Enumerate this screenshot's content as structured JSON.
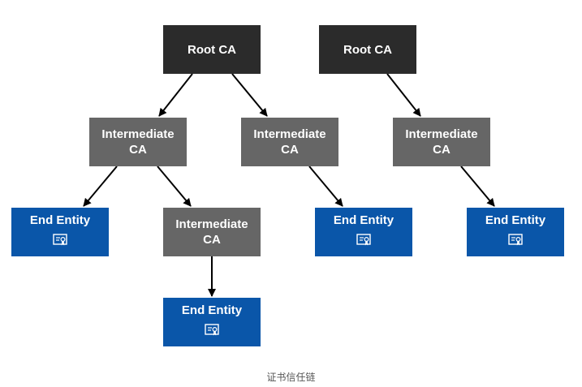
{
  "diagram": {
    "caption": "证书信任链",
    "colors": {
      "root": "#2b2b2b",
      "intermediate": "#666666",
      "end_entity": "#0a56a9",
      "arrow": "#000000"
    },
    "nodes": [
      {
        "id": "root1",
        "type": "root",
        "lines": [
          "Root CA"
        ]
      },
      {
        "id": "root2",
        "type": "root",
        "lines": [
          "Root CA"
        ]
      },
      {
        "id": "int1",
        "type": "intermediate",
        "lines": [
          "Intermediate",
          "CA"
        ]
      },
      {
        "id": "int2",
        "type": "intermediate",
        "lines": [
          "Intermediate",
          "CA"
        ]
      },
      {
        "id": "int3",
        "type": "intermediate",
        "lines": [
          "Intermediate",
          "CA"
        ]
      },
      {
        "id": "int4",
        "type": "intermediate",
        "lines": [
          "Intermediate",
          "CA"
        ]
      },
      {
        "id": "end1",
        "type": "end",
        "lines": [
          "End Entity"
        ],
        "icon": "certificate-icon"
      },
      {
        "id": "end2",
        "type": "end",
        "lines": [
          "End Entity"
        ],
        "icon": "certificate-icon"
      },
      {
        "id": "end3",
        "type": "end",
        "lines": [
          "End Entity"
        ],
        "icon": "certificate-icon"
      },
      {
        "id": "end4",
        "type": "end",
        "lines": [
          "End Entity"
        ],
        "icon": "certificate-icon"
      }
    ],
    "edges": [
      {
        "from": "root1",
        "to": "int1"
      },
      {
        "from": "root1",
        "to": "int2"
      },
      {
        "from": "root2",
        "to": "int3"
      },
      {
        "from": "int1",
        "to": "end1"
      },
      {
        "from": "int1",
        "to": "int4"
      },
      {
        "from": "int4",
        "to": "end4"
      },
      {
        "from": "int2",
        "to": "end2"
      },
      {
        "from": "int3",
        "to": "end3"
      }
    ]
  }
}
